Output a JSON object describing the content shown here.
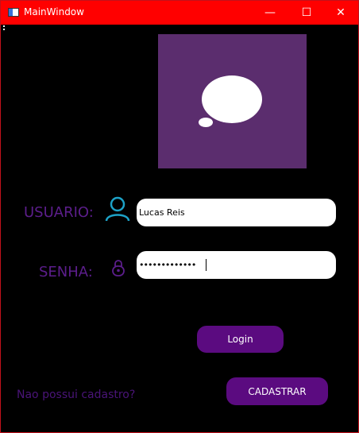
{
  "window": {
    "title": "MainWindow",
    "minimize_icon": "—",
    "maximize_icon": "☐",
    "close_icon": "✕"
  },
  "form": {
    "user_label": "USUARIO:",
    "user_value": "Lucas Reis",
    "password_label": "SENHA:",
    "password_value": "•••••••••••••"
  },
  "buttons": {
    "login": "Login",
    "signup": "CADASTRAR",
    "no_account": "Nao possui cadastro?"
  },
  "colors": {
    "titlebar": "#ff0000",
    "logo_bg": "#5b2d6e",
    "accent_purple": "#5b0b80",
    "label_purple": "#5c1e8c",
    "user_icon": "#1da2c7"
  }
}
